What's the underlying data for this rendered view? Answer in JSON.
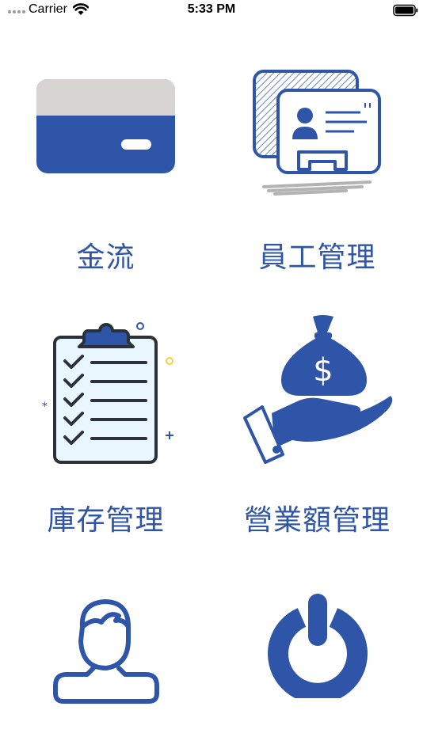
{
  "status_bar": {
    "carrier": "Carrier",
    "time": "5:33 PM"
  },
  "colors": {
    "accent": "#2f55a8",
    "card_stripe": "#d9d4d4",
    "dark_outline": "#2b3138",
    "yellow_dot": "#f2d33b"
  },
  "menu": {
    "cash_flow": {
      "label": "金流",
      "icon": "credit-card-icon"
    },
    "staff": {
      "label": "員工管理",
      "icon": "id-card-icon"
    },
    "inventory": {
      "label": "庫存管理",
      "icon": "clipboard-checklist-icon"
    },
    "revenue": {
      "label": "營業額管理",
      "icon": "money-bag-hand-icon"
    },
    "profile": {
      "label": "",
      "icon": "user-icon"
    },
    "logout": {
      "label": "",
      "icon": "power-icon"
    }
  }
}
